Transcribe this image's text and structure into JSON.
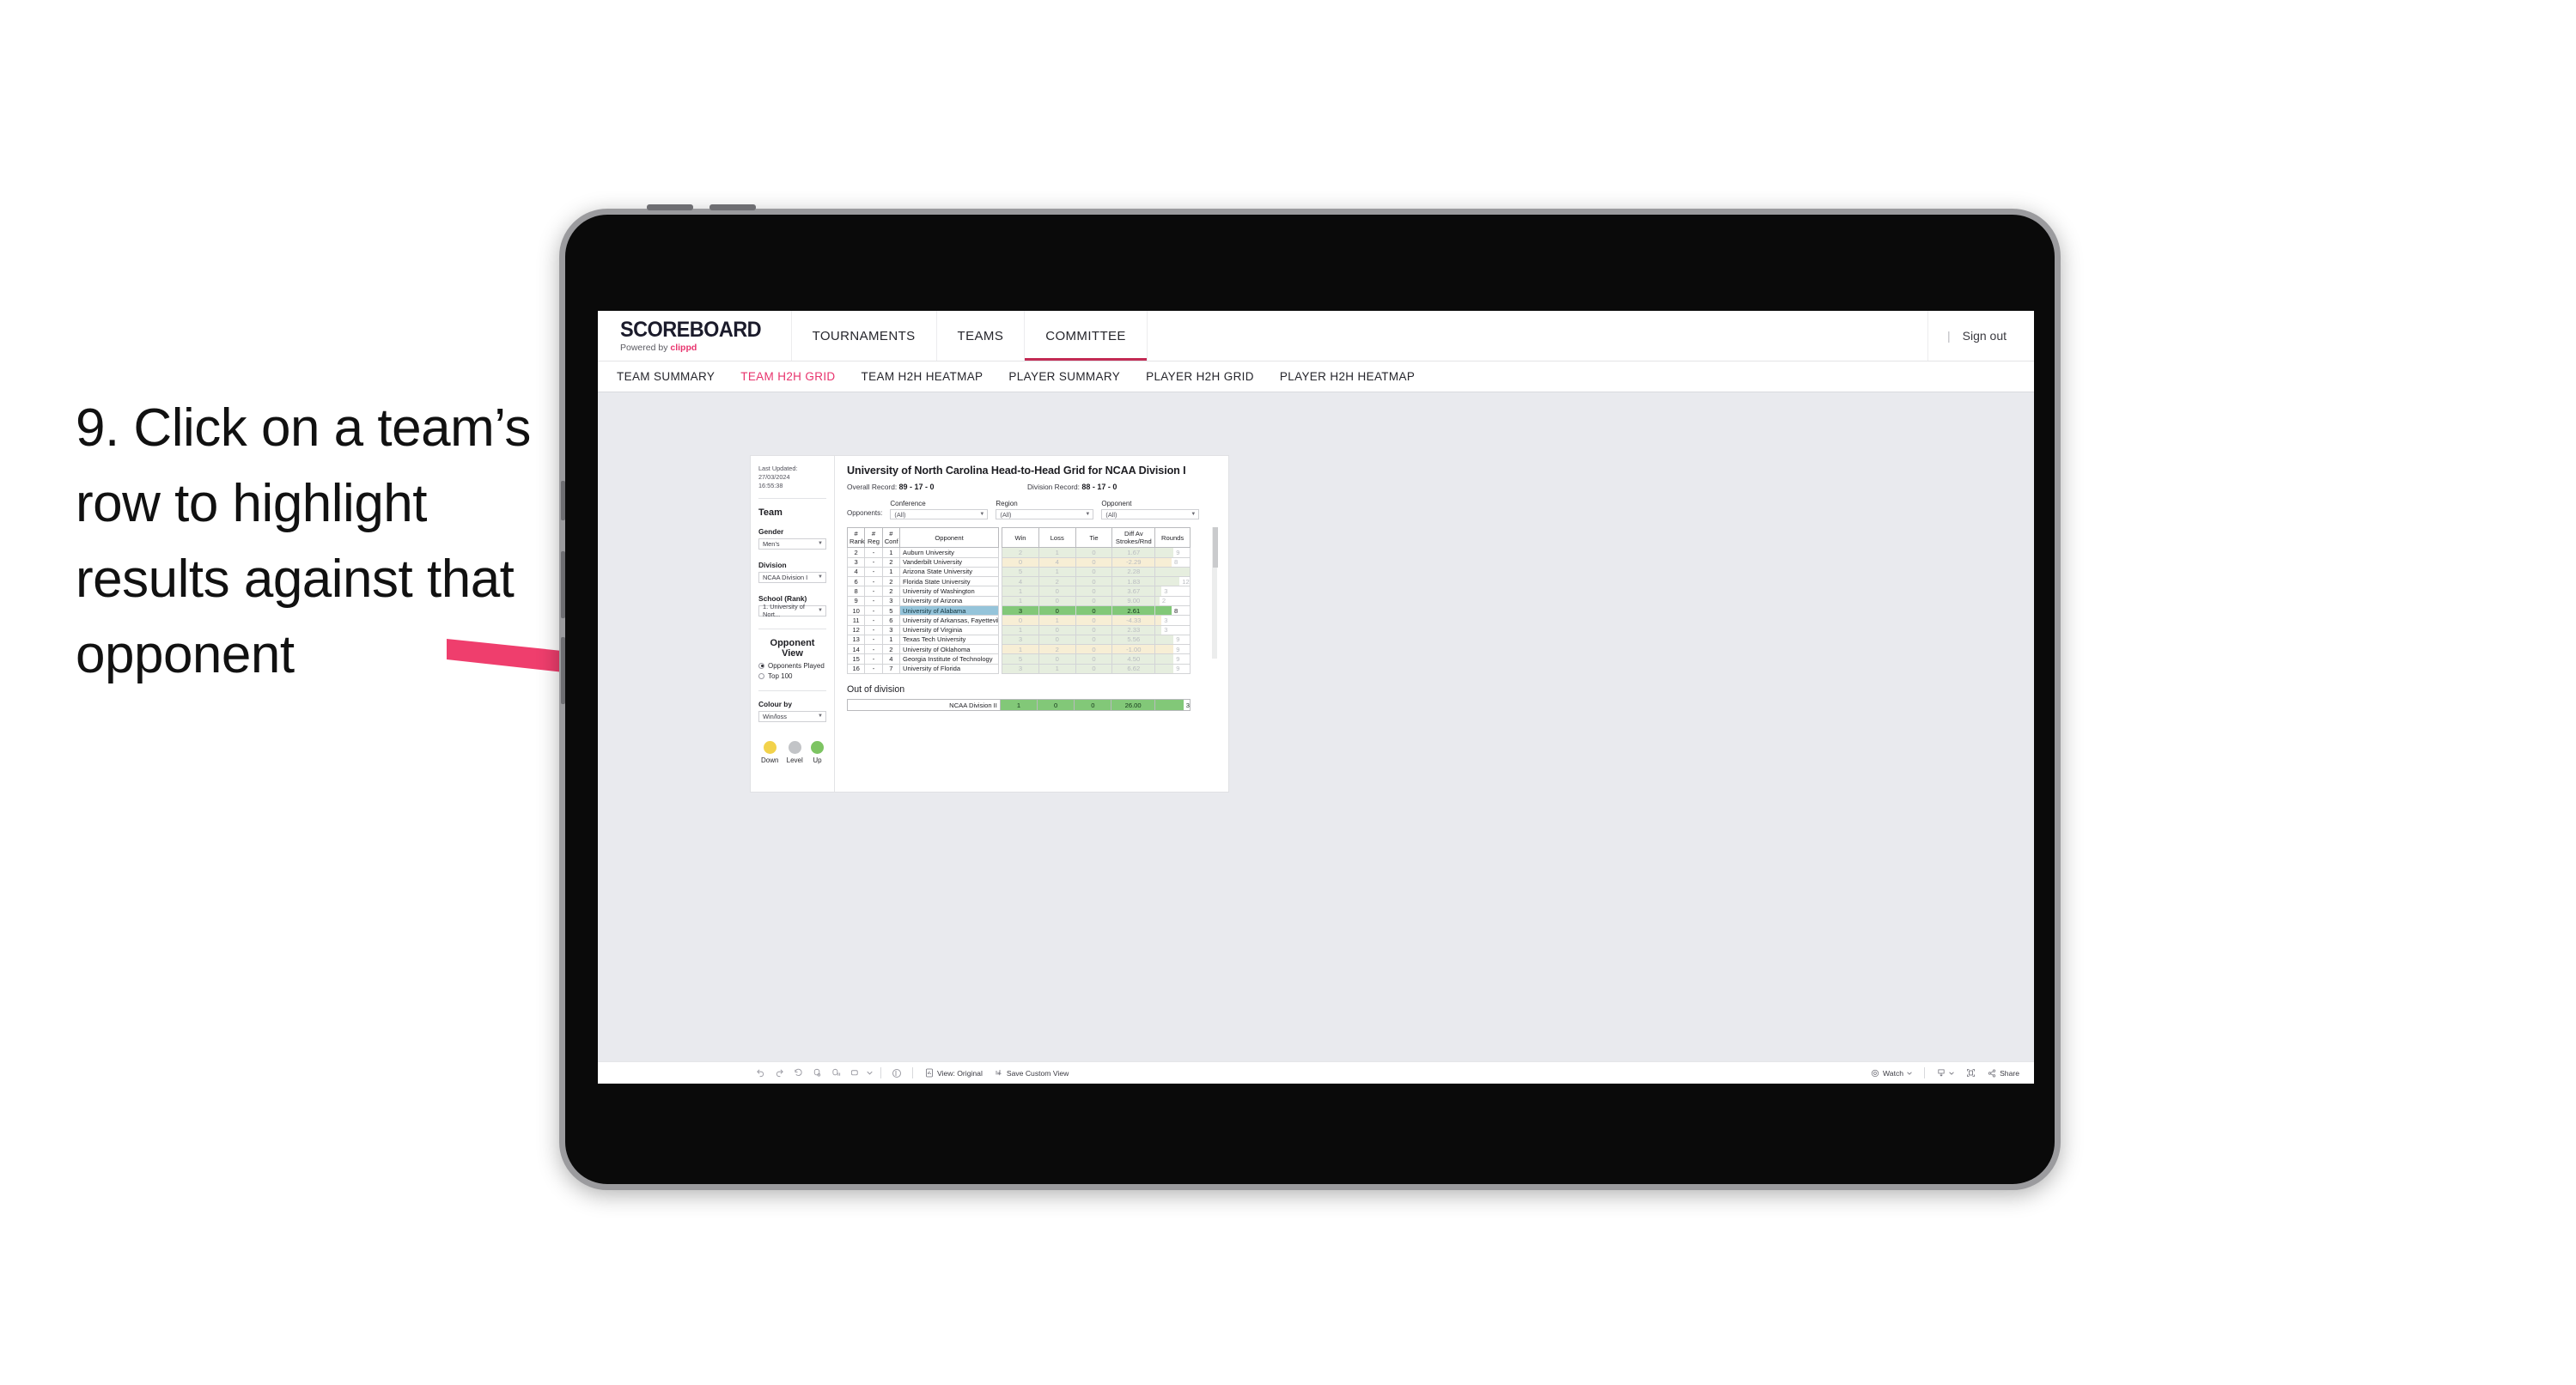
{
  "caption": "9. Click on a team’s row to highlight results against that opponent",
  "brand": {
    "title": "SCOREBOARD",
    "powered_prefix": "Powered by ",
    "powered_name": "clippd"
  },
  "topnav": {
    "items": [
      {
        "label": "TOURNAMENTS",
        "active": false
      },
      {
        "label": "TEAMS",
        "active": false
      },
      {
        "label": "COMMITTEE",
        "active": true
      }
    ],
    "separator": "|",
    "signout": "Sign out"
  },
  "subnav": {
    "items": [
      {
        "label": "TEAM SUMMARY",
        "active": false
      },
      {
        "label": "TEAM H2H GRID",
        "active": true
      },
      {
        "label": "TEAM H2H HEATMAP",
        "active": false
      },
      {
        "label": "PLAYER SUMMARY",
        "active": false
      },
      {
        "label": "PLAYER H2H GRID",
        "active": false
      },
      {
        "label": "PLAYER H2H HEATMAP",
        "active": false
      }
    ]
  },
  "sidebar": {
    "last_updated_label": "Last Updated:",
    "last_updated_date": "27/03/2024",
    "last_updated_time": "16:55:38",
    "team_heading": "Team",
    "gender_label": "Gender",
    "gender_value": "Men’s",
    "division_label": "Division",
    "division_value": "NCAA Division I",
    "school_label": "School (Rank)",
    "school_value": "1. University of Nort...",
    "opponent_view_heading": "Opponent View",
    "opponent_view_options": [
      {
        "label": "Opponents Played",
        "selected": true
      },
      {
        "label": "Top 100",
        "selected": false
      }
    ],
    "colour_by_label": "Colour by",
    "colour_by_value": "Win/loss",
    "legend": [
      {
        "label": "Down",
        "color": "#f2d24b"
      },
      {
        "label": "Level",
        "color": "#c2c4c7"
      },
      {
        "label": "Up",
        "color": "#7dc462"
      }
    ]
  },
  "main": {
    "title": "University of North Carolina Head-to-Head Grid for NCAA Division I",
    "overall_record_label": "Overall Record:",
    "overall_record_value": "89 - 17 - 0",
    "division_record_label": "Division Record:",
    "division_record_value": "88 - 17 - 0",
    "opponents_label": "Opponents:",
    "filters": [
      {
        "label": "Conference",
        "value": "(All)"
      },
      {
        "label": "Region",
        "value": "(All)"
      },
      {
        "label": "Opponent",
        "value": "(All)"
      }
    ]
  },
  "chart_data": {
    "type": "table",
    "title": "University of North Carolina Head-to-Head Grid for NCAA Division I",
    "columns": [
      "# Rank",
      "# Reg",
      "# Conf",
      "Opponent",
      "Win",
      "Loss",
      "Tie",
      "Diff Av Strokes/Rnd",
      "Rounds"
    ],
    "header_lines": {
      "rank": [
        "#",
        "Rank"
      ],
      "reg": [
        "#",
        "Reg"
      ],
      "conf": [
        "#",
        "Conf"
      ],
      "opponent": [
        "Opponent"
      ],
      "win": [
        "Win"
      ],
      "loss": [
        "Loss"
      ],
      "tie": [
        "Tie"
      ],
      "diff": [
        "Diff Av",
        "Strokes/Rnd"
      ],
      "rounds": [
        "Rounds"
      ]
    },
    "rounds_max": 17,
    "rows": [
      {
        "rank": "2",
        "reg": "-",
        "conf": "1",
        "opponent": "Auburn University",
        "win": "2",
        "loss": "1",
        "tie": "0",
        "diff": "1.67",
        "rounds": "9",
        "rounds_val": 9,
        "result": "up",
        "selected": false
      },
      {
        "rank": "3",
        "reg": "-",
        "conf": "2",
        "opponent": "Vanderbilt University",
        "win": "0",
        "loss": "4",
        "tie": "0",
        "diff": "-2.29",
        "rounds": "8",
        "rounds_val": 8,
        "result": "down",
        "selected": false
      },
      {
        "rank": "4",
        "reg": "-",
        "conf": "1",
        "opponent": "Arizona State University",
        "win": "5",
        "loss": "1",
        "tie": "0",
        "diff": "2.28",
        "rounds": "17",
        "rounds_val": 17,
        "result": "up",
        "selected": false
      },
      {
        "rank": "6",
        "reg": "-",
        "conf": "2",
        "opponent": "Florida State University",
        "win": "4",
        "loss": "2",
        "tie": "0",
        "diff": "1.83",
        "rounds": "12",
        "rounds_val": 12,
        "result": "up",
        "selected": false
      },
      {
        "rank": "8",
        "reg": "-",
        "conf": "2",
        "opponent": "University of Washington",
        "win": "1",
        "loss": "0",
        "tie": "0",
        "diff": "3.67",
        "rounds": "3",
        "rounds_val": 3,
        "result": "up",
        "selected": false
      },
      {
        "rank": "9",
        "reg": "-",
        "conf": "3",
        "opponent": "University of Arizona",
        "win": "1",
        "loss": "0",
        "tie": "0",
        "diff": "9.00",
        "rounds": "2",
        "rounds_val": 2,
        "result": "up",
        "selected": false
      },
      {
        "rank": "10",
        "reg": "-",
        "conf": "5",
        "opponent": "University of Alabama",
        "win": "3",
        "loss": "0",
        "tie": "0",
        "diff": "2.61",
        "rounds": "8",
        "rounds_val": 8,
        "result": "up",
        "selected": true
      },
      {
        "rank": "11",
        "reg": "-",
        "conf": "6",
        "opponent": "University of Arkansas, Fayetteville",
        "win": "0",
        "loss": "1",
        "tie": "0",
        "diff": "-4.33",
        "rounds": "3",
        "rounds_val": 3,
        "result": "down",
        "selected": false
      },
      {
        "rank": "12",
        "reg": "-",
        "conf": "3",
        "opponent": "University of Virginia",
        "win": "1",
        "loss": "0",
        "tie": "0",
        "diff": "2.33",
        "rounds": "3",
        "rounds_val": 3,
        "result": "up",
        "selected": false
      },
      {
        "rank": "13",
        "reg": "-",
        "conf": "1",
        "opponent": "Texas Tech University",
        "win": "3",
        "loss": "0",
        "tie": "0",
        "diff": "5.56",
        "rounds": "9",
        "rounds_val": 9,
        "result": "up",
        "selected": false
      },
      {
        "rank": "14",
        "reg": "-",
        "conf": "2",
        "opponent": "University of Oklahoma",
        "win": "1",
        "loss": "2",
        "tie": "0",
        "diff": "-1.00",
        "rounds": "9",
        "rounds_val": 9,
        "result": "down",
        "selected": false
      },
      {
        "rank": "15",
        "reg": "-",
        "conf": "4",
        "opponent": "Georgia Institute of Technology",
        "win": "5",
        "loss": "0",
        "tie": "0",
        "diff": "4.50",
        "rounds": "9",
        "rounds_val": 9,
        "result": "up",
        "selected": false
      },
      {
        "rank": "16",
        "reg": "-",
        "conf": "7",
        "opponent": "University of Florida",
        "win": "3",
        "loss": "1",
        "tie": "0",
        "diff": "6.62",
        "rounds": "9",
        "rounds_val": 9,
        "result": "up",
        "selected": false
      }
    ],
    "out_of_division": {
      "title": "Out of division",
      "label": "NCAA Division II",
      "win": "1",
      "loss": "0",
      "tie": "0",
      "diff": "26.00",
      "rounds": "3"
    },
    "colors": {
      "selected_row": "#95c4da",
      "selected_value": "#82c878",
      "up": "#e6eedf",
      "down": "#f7eed5",
      "accent": "#e8336d"
    }
  },
  "toolbar": {
    "view_label": "View: Original",
    "save_label": "Save Custom View",
    "watch_label": "Watch",
    "share_label": "Share"
  }
}
